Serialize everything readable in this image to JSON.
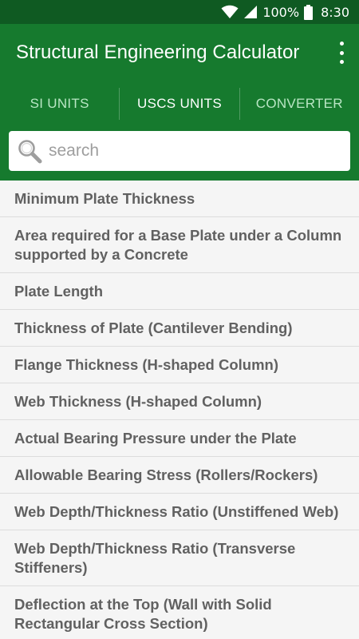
{
  "status_bar": {
    "battery_percent": "100%",
    "time": "8:30"
  },
  "app_bar": {
    "title": "Structural Engineering Calculator"
  },
  "tabs": [
    {
      "label": "SI UNITS",
      "active": false
    },
    {
      "label": "USCS UNITS",
      "active": true
    },
    {
      "label": "CONVERTER",
      "active": false
    }
  ],
  "search": {
    "placeholder": "search",
    "value": ""
  },
  "list": {
    "items": [
      "Minimum Plate Thickness",
      "Area required for a Base Plate under a Column supported by a Concrete",
      "Plate Length",
      "Thickness of Plate (Cantilever Bending)",
      "Flange Thickness (H-shaped Column)",
      "Web Thickness (H-shaped Column)",
      "Actual Bearing Pressure under the Plate",
      "Allowable Bearing Stress (Rollers/Rockers)",
      "Web Depth/Thickness Ratio (Unstiffened Web)",
      "Web Depth/Thickness Ratio (Transverse Stiffeners)",
      "Deflection at the Top (Wall with Solid Rectangular Cross Section)"
    ]
  },
  "colors": {
    "status_bar": "#0f5a22",
    "primary": "#167a2e",
    "tab_active": "#ffffff",
    "tab_inactive": "#b9e6c4",
    "list_text": "#616161",
    "list_bg": "#f5f5f5"
  },
  "icons": [
    "wifi-icon",
    "signal-icon",
    "battery-icon",
    "overflow-menu-icon",
    "search-icon"
  ]
}
